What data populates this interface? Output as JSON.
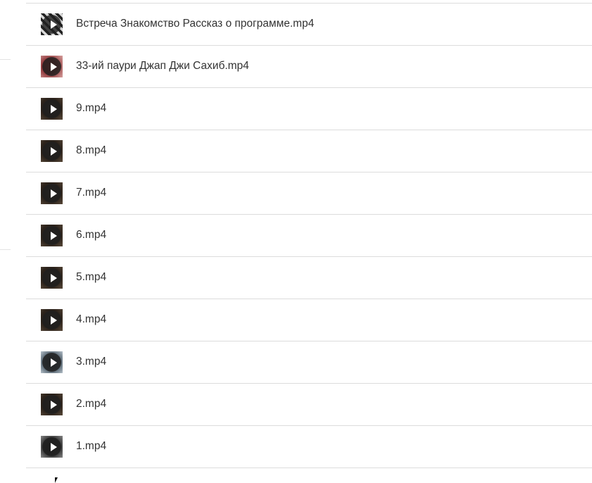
{
  "files": [
    {
      "name": "Встреча Знакомство Рассказ о программе.mp4",
      "thumb": "dark-mosaic"
    },
    {
      "name": "33-ий паури Джап Джи Сахиб.mp4",
      "thumb": "red"
    },
    {
      "name": "9.mp4",
      "thumb": "brown"
    },
    {
      "name": "8.mp4",
      "thumb": "brown"
    },
    {
      "name": "7.mp4",
      "thumb": "brown"
    },
    {
      "name": "6.mp4",
      "thumb": "brown"
    },
    {
      "name": "5.mp4",
      "thumb": "brown"
    },
    {
      "name": "4.mp4",
      "thumb": "brown"
    },
    {
      "name": "3.mp4",
      "thumb": "bluegrey"
    },
    {
      "name": "2.mp4",
      "thumb": "brown"
    },
    {
      "name": "1.mp4",
      "thumb": "mono"
    }
  ],
  "icons": {
    "play": "play-icon",
    "thumbnail": "video-thumbnail",
    "cursor": "mouse-cursor-icon"
  },
  "colors": {
    "text": "#333333",
    "divider": "#dcdcdc",
    "background": "#ffffff"
  }
}
